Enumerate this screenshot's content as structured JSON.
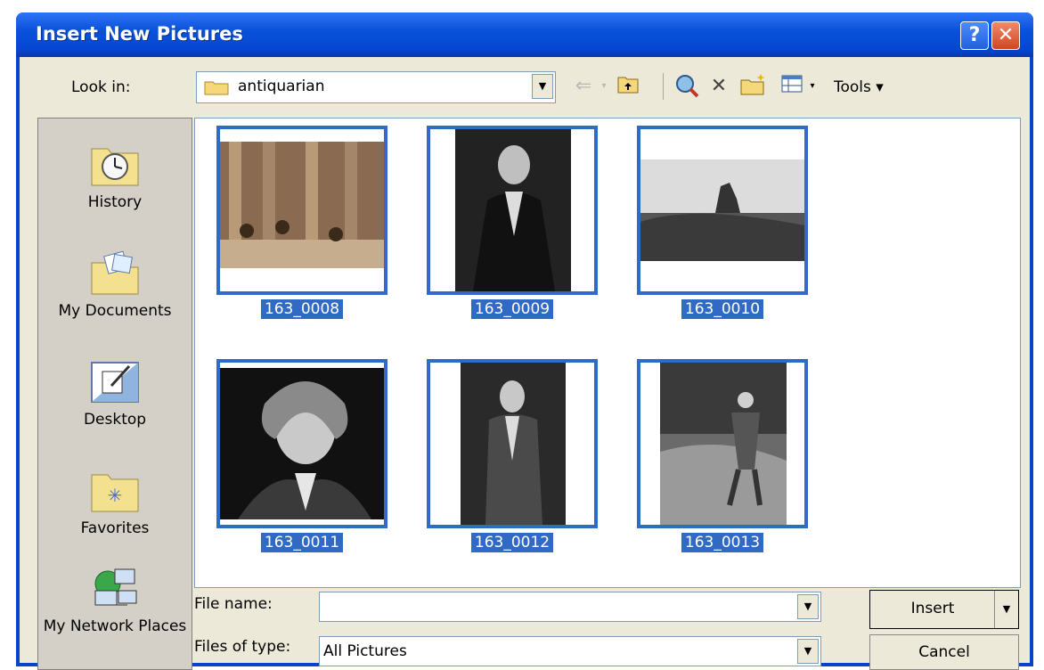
{
  "window": {
    "title": "Insert New Pictures"
  },
  "toolbar": {
    "look_in_label": "Look in:",
    "look_in_value": "antiquarian",
    "tools_label": "Tools ▾"
  },
  "places": [
    {
      "label": "History",
      "icon": "history-icon"
    },
    {
      "label": "My Documents",
      "icon": "my-documents-icon"
    },
    {
      "label": "Desktop",
      "icon": "desktop-icon"
    },
    {
      "label": "Favorites",
      "icon": "favorites-icon"
    },
    {
      "label": "My Network Places",
      "icon": "network-places-icon"
    }
  ],
  "files": [
    {
      "name": "163_0008"
    },
    {
      "name": "163_0009"
    },
    {
      "name": "163_0010"
    },
    {
      "name": "163_0011"
    },
    {
      "name": "163_0012"
    },
    {
      "name": "163_0013"
    }
  ],
  "form": {
    "file_name_label": "File name:",
    "file_name_value": "",
    "files_of_type_label": "Files of type:",
    "files_of_type_value": "All Pictures"
  },
  "buttons": {
    "insert": "Insert",
    "cancel": "Cancel"
  },
  "colors": {
    "title_bar": "#0a52db",
    "selection": "#316ac5",
    "dialog_bg": "#ece9d8"
  }
}
